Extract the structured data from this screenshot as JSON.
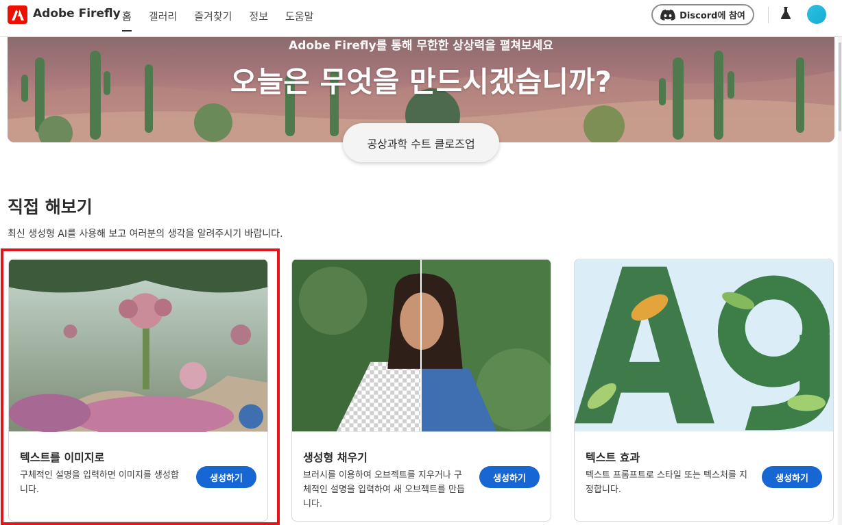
{
  "nav": {
    "brand": "Adobe Firefly",
    "links": [
      "홈",
      "갤러리",
      "즐겨찾기",
      "정보",
      "도움말"
    ],
    "discord_label": "Discord에 참여"
  },
  "hero": {
    "subtitle": "Adobe Firefly를 통해 무한한 상상력을 펼쳐보세요",
    "title": "오늘은 무엇을 만드시겠습니까?",
    "prompt_example": "공상과학 수트 클로즈업"
  },
  "section": {
    "title": "직접 해보기",
    "description": "최신 생성형 AI를 사용해 보고 여러분의 생각을 알려주시기 바랍니다."
  },
  "cards": [
    {
      "title": "텍스트를 이미지로",
      "description": "구체적인 설명을 입력하면 이미지를 생성합니다.",
      "button": "생성하기"
    },
    {
      "title": "생성형 채우기",
      "description": "브러시를 이용하여 오브젝트를 지우거나 구체적인 설명을 입력하여 새 오브젝트를 만듭니다.",
      "button": "생성하기"
    },
    {
      "title": "텍스트 효과",
      "description": "텍스트 프롬프트로 스타일 또는 텍스처를 지정합니다.",
      "button": "생성하기"
    }
  ],
  "colors": {
    "accent": "#1666d4",
    "highlight": "#e3151b",
    "brand_red": "#eb1000"
  }
}
